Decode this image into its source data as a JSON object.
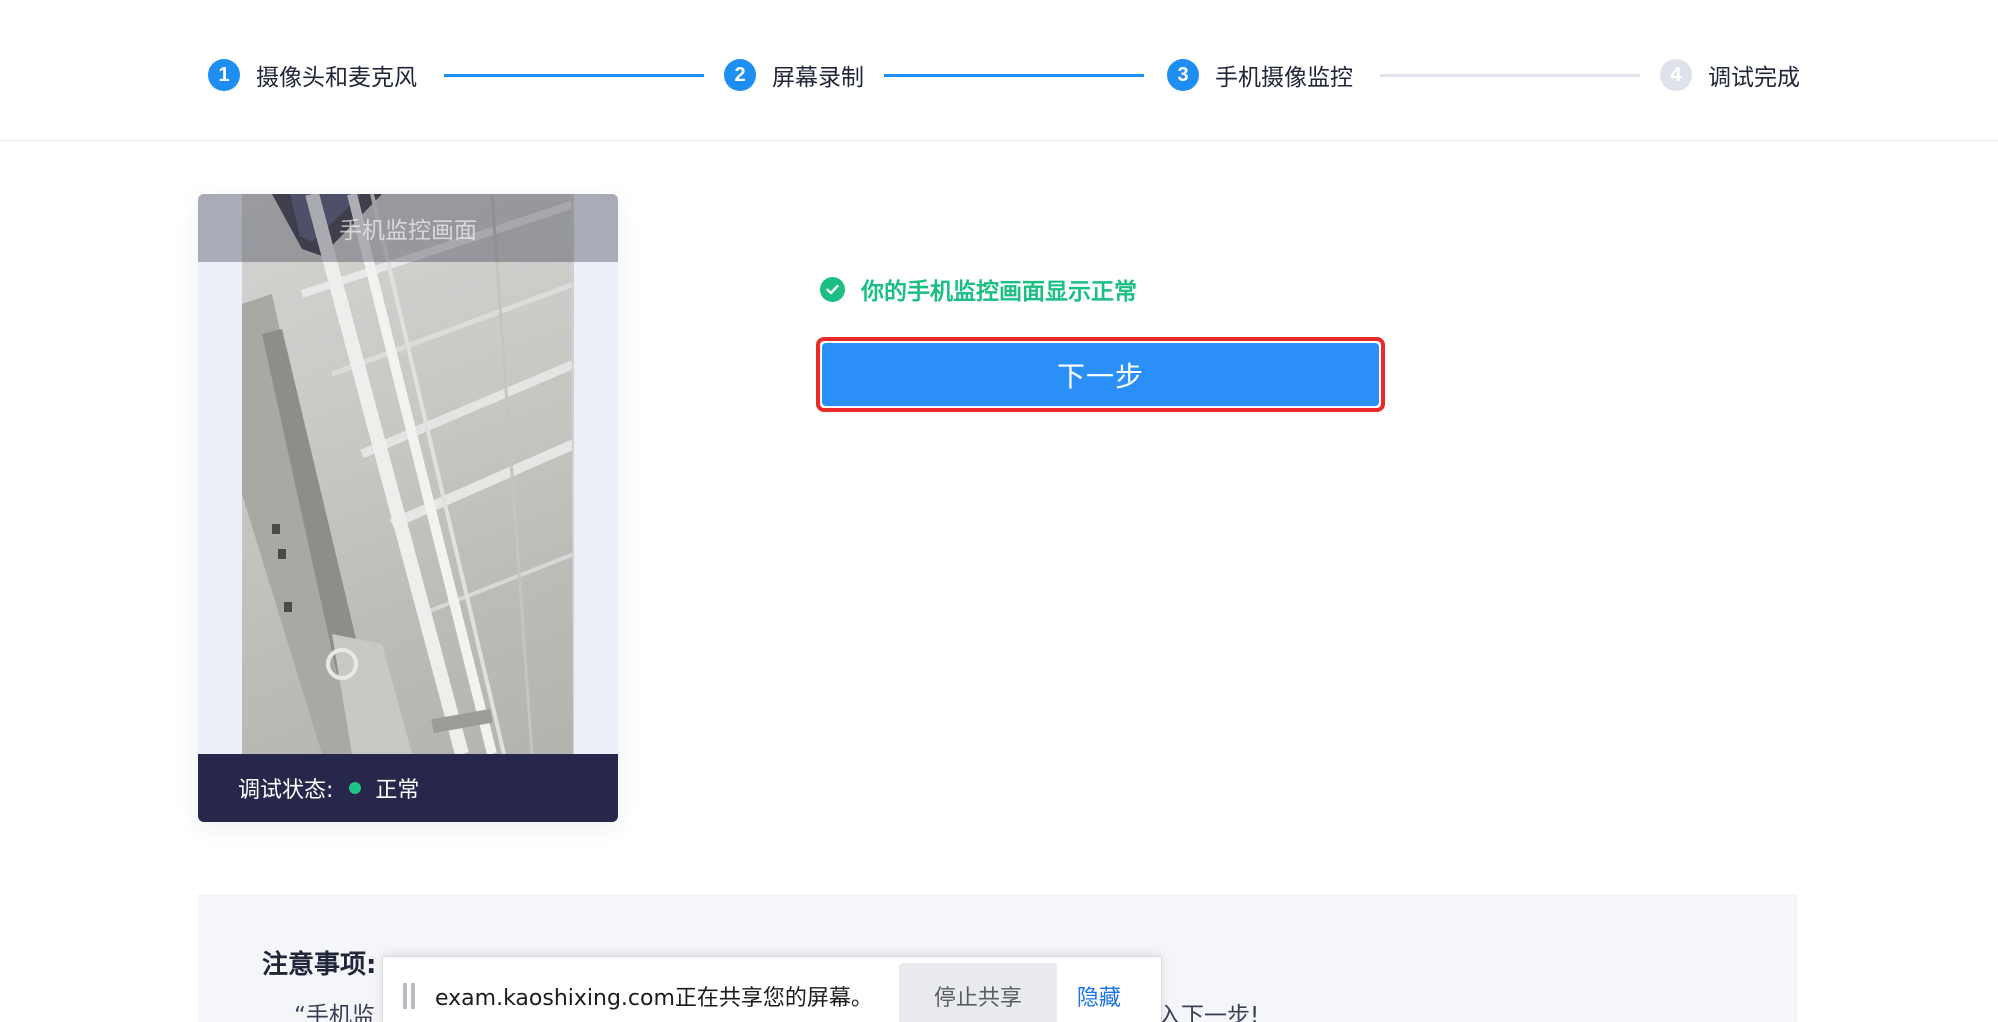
{
  "steps": [
    {
      "num": "1",
      "label": "摄像头和麦克风",
      "state": "done"
    },
    {
      "num": "2",
      "label": "屏幕录制",
      "state": "done"
    },
    {
      "num": "3",
      "label": "手机摄像监控",
      "state": "active"
    },
    {
      "num": "4",
      "label": "调试完成",
      "state": "pending"
    }
  ],
  "preview": {
    "title": "手机监控画面",
    "status_label": "调试状态:",
    "status_value": "正常"
  },
  "result": {
    "message": "你的手机监控画面显示正常",
    "next_label": "下一步"
  },
  "notice": {
    "title": "注意事项:",
    "text_start": "“手机监",
    "text_end": "入下一步!"
  },
  "share_bar": {
    "message": "exam.kaoshixing.com正在共享您的屏幕。",
    "stop_label": "停止共享",
    "hide_label": "隐藏"
  },
  "colors": {
    "primary": "#1f8ef2",
    "success": "#1bbf83",
    "highlight_border": "#ec2a2a",
    "status_bar": "#26274a"
  }
}
